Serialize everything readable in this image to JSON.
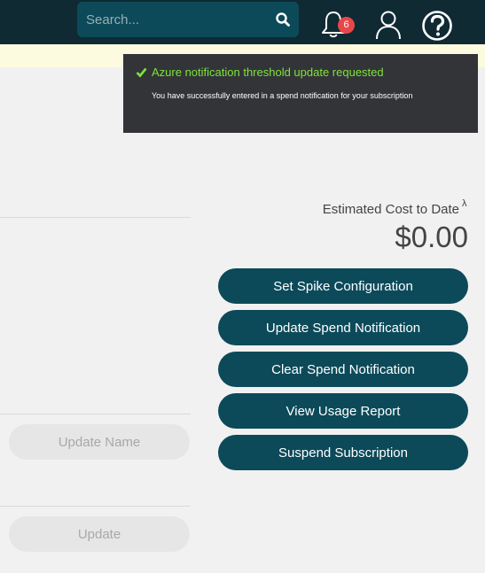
{
  "header": {
    "search_placeholder": "Search...",
    "notification_count": "6"
  },
  "toast": {
    "title": "Azure notification threshold update requested",
    "message": "You have successfully entered in a spend notification for your subscription",
    "title_color": "#7ee33a"
  },
  "cost": {
    "label": "Estimated Cost to Date",
    "label_sup": "λ",
    "value": "$0.00"
  },
  "actions": {
    "set_spike": "Set Spike Configuration",
    "update_spend": "Update Spend Notification",
    "clear_spend": "Clear Spend Notification",
    "view_usage": "View Usage Report",
    "suspend": "Suspend Subscription"
  },
  "form": {
    "update_name_label": "Update Name",
    "update_label": "Update"
  },
  "colors": {
    "topbar": "#0f2a33",
    "accent": "#0c4a59",
    "badge": "#e8474a"
  },
  "icons": {
    "search": "search-icon",
    "bell": "bell-icon",
    "user": "user-icon",
    "help": "help-icon",
    "check": "check-icon"
  }
}
